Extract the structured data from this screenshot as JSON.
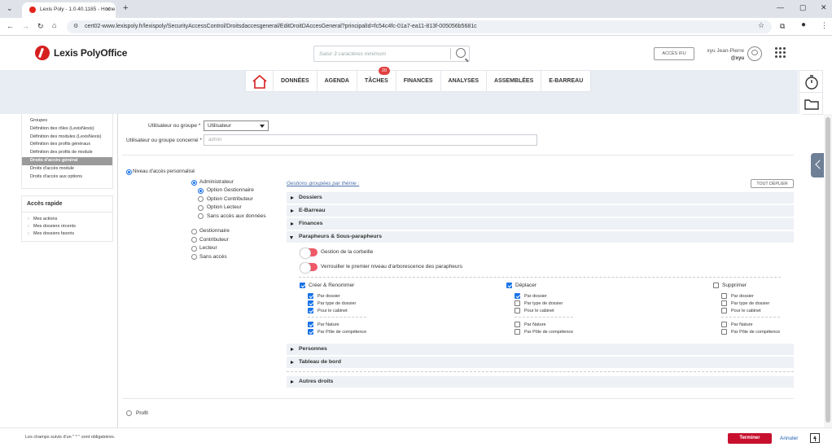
{
  "browser": {
    "tab_title": "Lexis Poly - 1.0.40.1185 - Home",
    "url": "cert02-www.lexispoly.fr/lexispoly/SecurityAccessControl/Droitsdaccesgeneral/EditDroitDAccesGeneral?principalId=fc54c4fc-01a7-ea11-813f-005056b5681c"
  },
  "header": {
    "logo": "Lexis PolyOffice",
    "search_placeholder": "Saisir 3 caractères minimum",
    "acces_ifu": "ACCÈS IFU",
    "user_name": "xyu Jean-Pierre",
    "user_login": "@xyu"
  },
  "nav": {
    "items": [
      "DONNÉES",
      "AGENDA",
      "TÂCHES",
      "FINANCES",
      "ANALYSES",
      "ASSEMBLÉES",
      "E-BARREAU"
    ],
    "taches_badge": "20"
  },
  "left_menu": {
    "items": [
      "Groupes",
      "Définition des rôles (LexisNexis)",
      "Définition des modules (LexisNexis)",
      "Définition des profils généraux",
      "Définition des profils de module",
      "Droits d'accès général",
      "Droits d'accès module",
      "Droits d'accès aux options"
    ],
    "active_index": 5
  },
  "quick_access": {
    "title": "Accès rapide",
    "items": [
      "Mes actions",
      "Mes dossiers récents",
      "Mes dossiers favoris"
    ]
  },
  "form": {
    "user_group_label": "Utilisateur ou groupe *",
    "user_group_value": "Utilisateur",
    "concerned_label": "Utilisateur ou groupe concerné *",
    "concerned_placeholder": "admin",
    "niveau_label": "Niveau d'accès personnalisé",
    "levels": [
      "Administrateur",
      "Option Gestionnaire",
      "Option Contributeur",
      "Option Lecteur",
      "Sans accès aux données",
      "Gestionnaire",
      "Contributeur",
      "Lecteur",
      "Sans accès"
    ],
    "profil_label": "Profil"
  },
  "groups": {
    "title": "Gestions groupées par thème :",
    "tout_deplier": "TOUT DÉPLIER",
    "sections": [
      "Dossiers",
      "E-Barreau",
      "Finances",
      "Parapheurs & Sous-parapheurs",
      "Personnes",
      "Tableau de bord",
      "Autres droits"
    ],
    "parapheurs": {
      "toggle1": "Gestion de la corbeille",
      "toggle2": "Verrouiller le premier niveau d'arborescence des parapheurs",
      "columns": [
        {
          "title": "Créer & Renommer",
          "checked": true,
          "items": [
            [
              "Par dossier",
              true
            ],
            [
              "Par type de dossier",
              true
            ],
            [
              "Pour le cabinet",
              true
            ],
            [
              "Par Nature",
              true
            ],
            [
              "Par Pôle de compétence",
              true
            ]
          ]
        },
        {
          "title": "Déplacer",
          "checked": true,
          "items": [
            [
              "Par dossier",
              true
            ],
            [
              "Par type de dossier",
              false
            ],
            [
              "Pour le cabinet",
              false
            ],
            [
              "Par Nature",
              false
            ],
            [
              "Par Pôle de compétence",
              false
            ]
          ]
        },
        {
          "title": "Supprimer",
          "checked": false,
          "items": [
            [
              "Par dossier",
              false
            ],
            [
              "Par type de dossier",
              false
            ],
            [
              "Pour le cabinet",
              false
            ],
            [
              "Par Nature",
              false
            ],
            [
              "Par Pôle de compétence",
              false
            ]
          ]
        }
      ]
    }
  },
  "footer": {
    "note": "Les champs suivis d'un \" * \" sont obligatoires.",
    "terminer": "Terminer",
    "annuler": "Annuler"
  }
}
